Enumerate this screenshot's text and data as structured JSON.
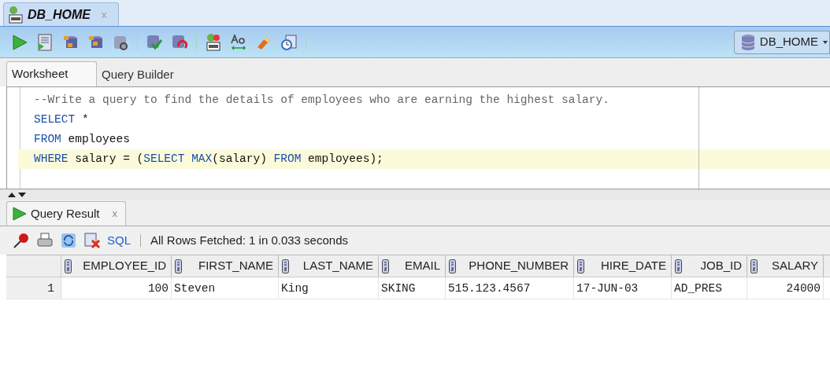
{
  "editor_tab": {
    "title": "DB_HOME",
    "close": "x"
  },
  "connection": {
    "label": "DB_HOME"
  },
  "worksheet_tabs": [
    {
      "label": "Worksheet",
      "selected": true
    },
    {
      "label": "Query Builder",
      "selected": false
    }
  ],
  "code_lines": [
    {
      "current": false,
      "tokens": [
        {
          "kind": "comment",
          "text": "--Write a query to find the details of employees who are earning the highest salary."
        }
      ]
    },
    {
      "current": false,
      "tokens": [
        {
          "kind": "keyword",
          "text": "SELECT"
        },
        {
          "kind": "plain",
          "text": " *"
        }
      ]
    },
    {
      "current": false,
      "tokens": [
        {
          "kind": "keyword",
          "text": "FROM"
        },
        {
          "kind": "plain",
          "text": " employees"
        }
      ]
    },
    {
      "current": true,
      "tokens": [
        {
          "kind": "keyword",
          "text": "WHERE"
        },
        {
          "kind": "plain",
          "text": " salary = ("
        },
        {
          "kind": "keyword",
          "text": "SELECT"
        },
        {
          "kind": "keyword",
          "text": " MAX"
        },
        {
          "kind": "plain",
          "text": "(salary) "
        },
        {
          "kind": "keyword",
          "text": "FROM"
        },
        {
          "kind": "plain",
          "text": " employees);"
        }
      ]
    }
  ],
  "result_tab": {
    "title": "Query Result",
    "close": "x"
  },
  "result_toolbar": {
    "sql_link": "SQL",
    "status": "All Rows Fetched: 1 in 0.033 seconds"
  },
  "table": {
    "columns": [
      "EMPLOYEE_ID",
      "FIRST_NAME",
      "LAST_NAME",
      "EMAIL",
      "PHONE_NUMBER",
      "HIRE_DATE",
      "JOB_ID",
      "SALARY"
    ],
    "rows": [
      {
        "number": "1",
        "cells": [
          "100",
          "Steven",
          "King",
          "SKING",
          "515.123.4567",
          "17-JUN-03",
          "AD_PRES",
          "24000"
        ]
      }
    ]
  }
}
